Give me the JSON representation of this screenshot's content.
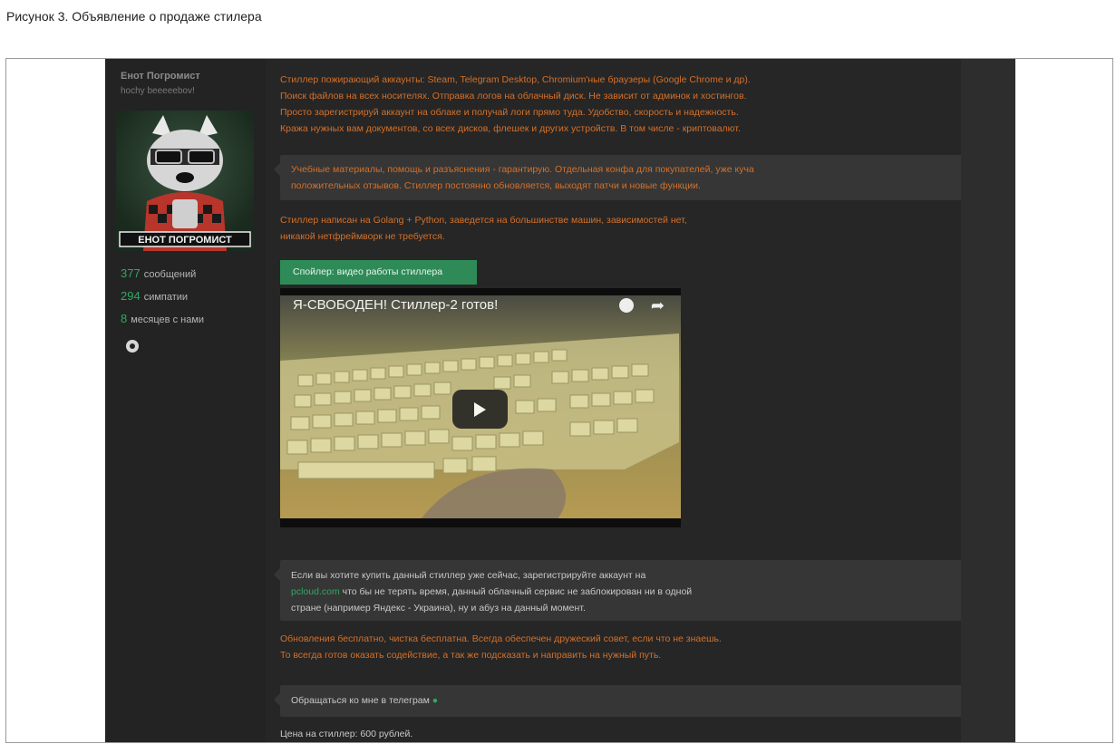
{
  "caption": "Рисунок 3. Объявление о продаже стилера",
  "user": {
    "name": "Енот Погромист",
    "title": "hochy beeeeebov!",
    "avatar_label": "ЕНОТ ПОГРОМИСТ",
    "stats": [
      {
        "num": "377",
        "label": "сообщений"
      },
      {
        "num": "294",
        "label": "симпатии"
      },
      {
        "num": "8",
        "label": "месяцев с нами"
      }
    ]
  },
  "post": {
    "para1": [
      "Стиллер пожирающий аккаунты: Steam, Telegram Desktop, Chromium'ные браузеры (Google Chrome и др).",
      "Поиск файлов на всех носителях. Отправка логов на облачный диск. Не зависит от админок и хостингов.",
      "Просто зарегистрируй аккаунт на облаке и получай логи прямо туда. Удобство, скорость и надежность.",
      "Кража нужных вам документов, со всех дисков, флешек и других устройств. В том числе - криптовалют."
    ],
    "quote1": [
      "Учебные материалы, помощь и разъяснения - гарантирую. Отдельная конфа для покупателей, уже куча",
      "положительных отзывов. Стиллер постоянно обновляется, выходят патчи и новые функции."
    ],
    "para2": [
      "Стиллер написан на Golang + Python, заведется на большинстве машин, зависимостей нет,",
      "никакой нетфреймворк не требуется."
    ],
    "spoiler_label": "Спойлер: видео работы стиллера",
    "video_title": "Я-СВОБОДЕН! Стиллер-2 готов!",
    "quote2": {
      "line1": "Если вы хотите купить данный стиллер уже сейчас, зарегистрируйте аккаунт на",
      "link": "pcloud.com",
      "line2": " что бы не терять время, данный облачный сервис не заблокирован ни в одной",
      "line3": "стране (например Яндекс - Украина), ну и абуз на данный момент."
    },
    "para3": [
      "Обновления бесплатно, чистка бесплатна. Всегда обеспечен дружеский совет, если что не знаешь.",
      "То всегда готов оказать содействие, а так же подсказать и направить на нужный путь."
    ],
    "contact": "Обращаться ко мне в телеграм",
    "price": "Цена на стиллер: 600 рублей."
  }
}
